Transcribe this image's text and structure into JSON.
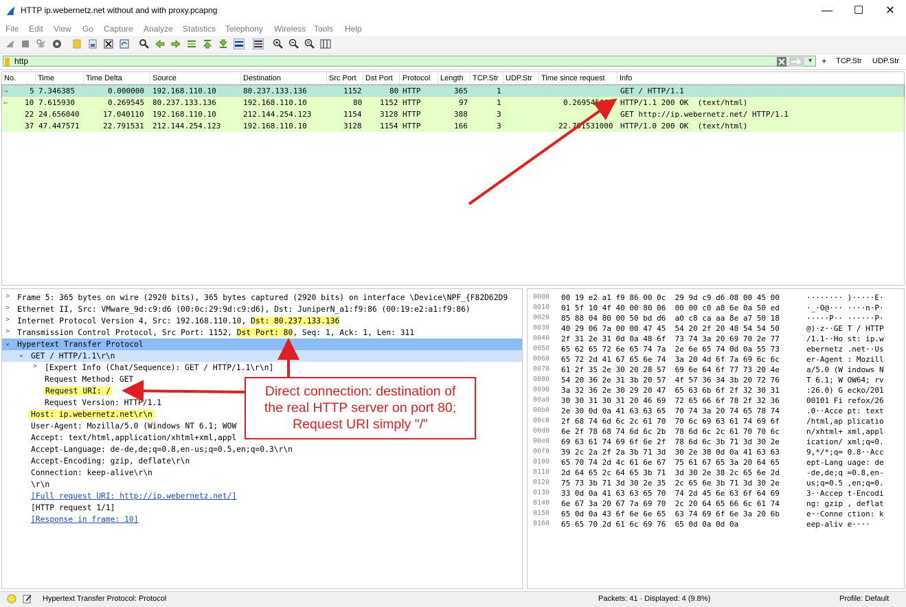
{
  "window": {
    "title": "HTTP ip.webernetz.net without and with proxy.pcapng"
  },
  "menu": [
    "File",
    "Edit",
    "View",
    "Go",
    "Capture",
    "Analyze",
    "Statistics",
    "Telephony",
    "Wireless",
    "Tools",
    "Help"
  ],
  "filter": {
    "value": "http",
    "btn_tcp": "TCP.Str",
    "btn_udp": "UDP.Str",
    "plus": "+"
  },
  "columns": [
    "No.",
    "Time",
    "Time Delta",
    "Source",
    "Destination",
    "Src Port",
    "Dst Port",
    "Protocol",
    "Length",
    "TCP.Str",
    "UDP.Str",
    "Time since request",
    "Info"
  ],
  "packets": [
    {
      "no": "5",
      "time": "7.346385",
      "delta": "0.000000",
      "src": "192.168.110.10",
      "dst": "80.237.133.136",
      "sport": "1152",
      "dport": "80",
      "proto": "HTTP",
      "len": "365",
      "tcpstr": "1",
      "udpstr": "",
      "since": "",
      "info": "GET / HTTP/1.1"
    },
    {
      "no": "10",
      "time": "7.615930",
      "delta": "0.269545",
      "src": "80.237.133.136",
      "dst": "192.168.110.10",
      "sport": "80",
      "dport": "1152",
      "proto": "HTTP",
      "len": "97",
      "tcpstr": "1",
      "udpstr": "",
      "since": "0.269545000",
      "info": "HTTP/1.1 200 OK  (text/html)"
    },
    {
      "no": "22",
      "time": "24.656040",
      "delta": "17.040110",
      "src": "192.168.110.10",
      "dst": "212.144.254.123",
      "sport": "1154",
      "dport": "3128",
      "proto": "HTTP",
      "len": "388",
      "tcpstr": "3",
      "udpstr": "",
      "since": "",
      "info": "GET http://ip.webernetz.net/ HTTP/1.1"
    },
    {
      "no": "37",
      "time": "47.447571",
      "delta": "22.791531",
      "src": "212.144.254.123",
      "dst": "192.168.110.10",
      "sport": "3128",
      "dport": "1154",
      "proto": "HTTP",
      "len": "166",
      "tcpstr": "3",
      "udpstr": "",
      "since": "22.791531000",
      "info": "HTTP/1.0 200 OK  (text/html)"
    }
  ],
  "details": {
    "frame": "Frame 5: 365 bytes on wire (2920 bits), 365 bytes captured (2920 bits) on interface \\Device\\NPF_{F82D62D9",
    "eth": "Ethernet II, Src: VMware_9d:c9:d6 (00:0c:29:9d:c9:d6), Dst: JuniperN_a1:f9:86 (00:19:e2:a1:f9:86)",
    "ip_a": "Internet Protocol Version 4, Src: 192.168.110.10, ",
    "ip_b": "Dst: 80.237.133.136",
    "tcp_a": "Transmission Control Protocol, Src Port: 1152, ",
    "tcp_b": "Dst Port: 80",
    "tcp_c": ", Seq: 1, Ack: 1, Len: 311",
    "http": "Hypertext Transfer Protocol",
    "get": "GET / HTTP/1.1\\r\\n",
    "expert": "[Expert Info (Chat/Sequence): GET / HTTP/1.1\\r\\n]",
    "method": "Request Method: GET",
    "uri": "Request URI: /",
    "version": "Request Version: HTTP/1.1",
    "host": "Host: ip.webernetz.net\\r\\n",
    "ua": "User-Agent: Mozilla/5.0 (Windows NT 6.1; WOW",
    "accept": "Accept: text/html,application/xhtml+xml,appl",
    "lang": "Accept-Language: de-de,de;q=0.8,en-us;q=0.5,en;q=0.3\\r\\n",
    "enc": "Accept-Encoding: gzip, deflate\\r\\n",
    "conn": "Connection: keep-alive\\r\\n",
    "crlf": "\\r\\n",
    "full": "[Full request URI: http://ip.webernetz.net/]",
    "reqn": "[HTTP request 1/1]",
    "resp": "[Response in frame: 10]"
  },
  "hexdump": [
    {
      "off": "0000",
      "b": "00 19 e2 a1 f9 86 00 0c  29 9d c9 d6 08 00 45 00",
      "a": "········ )·····E·"
    },
    {
      "off": "0010",
      "b": "01 5f 10 4f 40 00 80 06  00 00 c0 a8 6e 0a 50 ed",
      "a": "·_·O@··· ····n·P·"
    },
    {
      "off": "0020",
      "b": "85 88 04 80 00 50 bd d6  a0 c8 ca aa 8e a7 50 18",
      "a": "·····P·· ······P·"
    },
    {
      "off": "0030",
      "b": "40 29 06 7a 00 00 47 45  54 20 2f 20 48 54 54 50",
      "a": "@)·z··GE T / HTTP"
    },
    {
      "off": "0040",
      "b": "2f 31 2e 31 0d 0a 48 6f  73 74 3a 20 69 70 2e 77",
      "a": "/1.1··Ho st: ip.w"
    },
    {
      "off": "0050",
      "b": "65 62 65 72 6e 65 74 7a  2e 6e 65 74 0d 0a 55 73",
      "a": "ebernetz .net··Us"
    },
    {
      "off": "0060",
      "b": "65 72 2d 41 67 65 6e 74  3a 20 4d 6f 7a 69 6c 6c",
      "a": "er-Agent : Mozill"
    },
    {
      "off": "0070",
      "b": "61 2f 35 2e 30 20 28 57  69 6e 64 6f 77 73 20 4e",
      "a": "a/5.0 (W indows N"
    },
    {
      "off": "0080",
      "b": "54 20 36 2e 31 3b 20 57  4f 57 36 34 3b 20 72 76",
      "a": "T 6.1; W OW64; rv"
    },
    {
      "off": "0090",
      "b": "3a 32 36 2e 30 29 20 47  65 63 6b 6f 2f 32 30 31",
      "a": ":26.0) G ecko/201"
    },
    {
      "off": "00a0",
      "b": "30 30 31 30 31 20 46 69  72 65 66 6f 78 2f 32 36",
      "a": "00101 Fi refox/26"
    },
    {
      "off": "00b0",
      "b": "2e 30 0d 0a 41 63 63 65  70 74 3a 20 74 65 78 74",
      "a": ".0··Acce pt: text"
    },
    {
      "off": "00c0",
      "b": "2f 68 74 6d 6c 2c 61 70  70 6c 69 63 61 74 69 6f",
      "a": "/html,ap plicatio"
    },
    {
      "off": "00d0",
      "b": "6e 2f 78 68 74 6d 6c 2b  78 6d 6c 2c 61 70 70 6c",
      "a": "n/xhtml+ xml,appl"
    },
    {
      "off": "00e0",
      "b": "69 63 61 74 69 6f 6e 2f  78 6d 6c 3b 71 3d 30 2e",
      "a": "ication/ xml;q=0."
    },
    {
      "off": "00f0",
      "b": "39 2c 2a 2f 2a 3b 71 3d  30 2e 38 0d 0a 41 63 63",
      "a": "9,*/*;q= 0.8··Acc"
    },
    {
      "off": "0100",
      "b": "65 70 74 2d 4c 61 6e 67  75 61 67 65 3a 20 64 65",
      "a": "ept-Lang uage: de"
    },
    {
      "off": "0110",
      "b": "2d 64 65 2c 64 65 3b 71  3d 30 2e 38 2c 65 6e 2d",
      "a": "-de,de;q =0.8,en-"
    },
    {
      "off": "0120",
      "b": "75 73 3b 71 3d 30 2e 35  2c 65 6e 3b 71 3d 30 2e",
      "a": "us;q=0.5 ,en;q=0."
    },
    {
      "off": "0130",
      "b": "33 0d 0a 41 63 63 65 70  74 2d 45 6e 63 6f 64 69",
      "a": "3··Accep t-Encodi"
    },
    {
      "off": "0140",
      "b": "6e 67 3a 20 67 7a 69 70  2c 20 64 65 66 6c 61 74",
      "a": "ng: gzip , deflat"
    },
    {
      "off": "0150",
      "b": "65 0d 0a 43 6f 6e 6e 65  63 74 69 6f 6e 3a 20 6b",
      "a": "e··Conne ction: k"
    },
    {
      "off": "0160",
      "b": "65 65 70 2d 61 6c 69 76  65 0d 0a 0d 0a",
      "a": "eep-aliv e····"
    }
  ],
  "status": {
    "field": "Hypertext Transfer Protocol: Protocol",
    "packets": "Packets: 41 · Displayed: 4 (9.8%)",
    "profile": "Profile: Default"
  },
  "annotation": {
    "line1": "Direct connection: destination of",
    "line2": "the real HTTP server on port 80;",
    "line3": "Request URI simply \"/\"",
    "color": "#e02020"
  }
}
